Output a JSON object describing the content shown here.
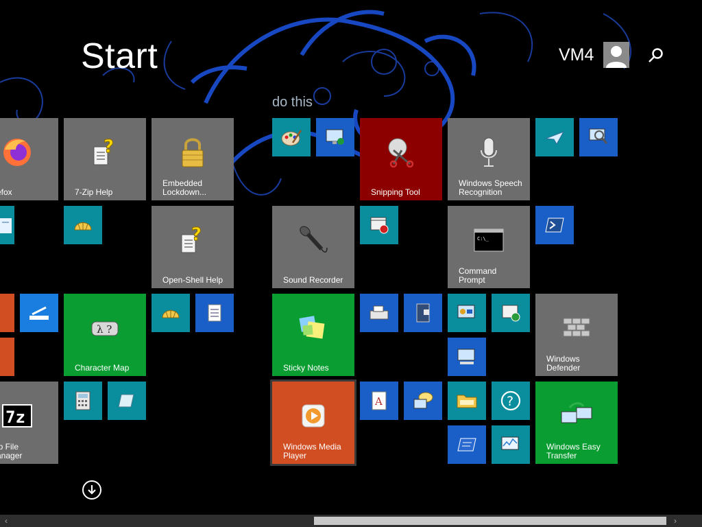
{
  "header": {
    "title": "Start",
    "user_name": "VM4"
  },
  "groups": [
    {
      "title": "do this"
    }
  ],
  "tiles": {
    "firefox": "efox",
    "seven_zip_help": "7-Zip Help",
    "embedded_lockdown": "Embedded Lockdown...",
    "openshell_help": "Open-Shell Help",
    "character_map": "Character Map",
    "seven_zip_fm": "ip File anager",
    "snipping_tool": "Snipping Tool",
    "speech_recognition": "Windows Speech Recognition",
    "sound_recorder": "Sound Recorder",
    "command_prompt": "Command Prompt",
    "sticky_notes": "Sticky Notes",
    "windows_defender": "Windows Defender",
    "media_player": "Windows Media Player",
    "easy_transfer": "Windows Easy Transfer"
  },
  "colors": {
    "gray": "#6d6d6d",
    "teal": "#0a8d9c",
    "blue": "#1a5fc8",
    "red": "#8d0000",
    "green": "#0a9e32",
    "orange": "#d14e23"
  }
}
